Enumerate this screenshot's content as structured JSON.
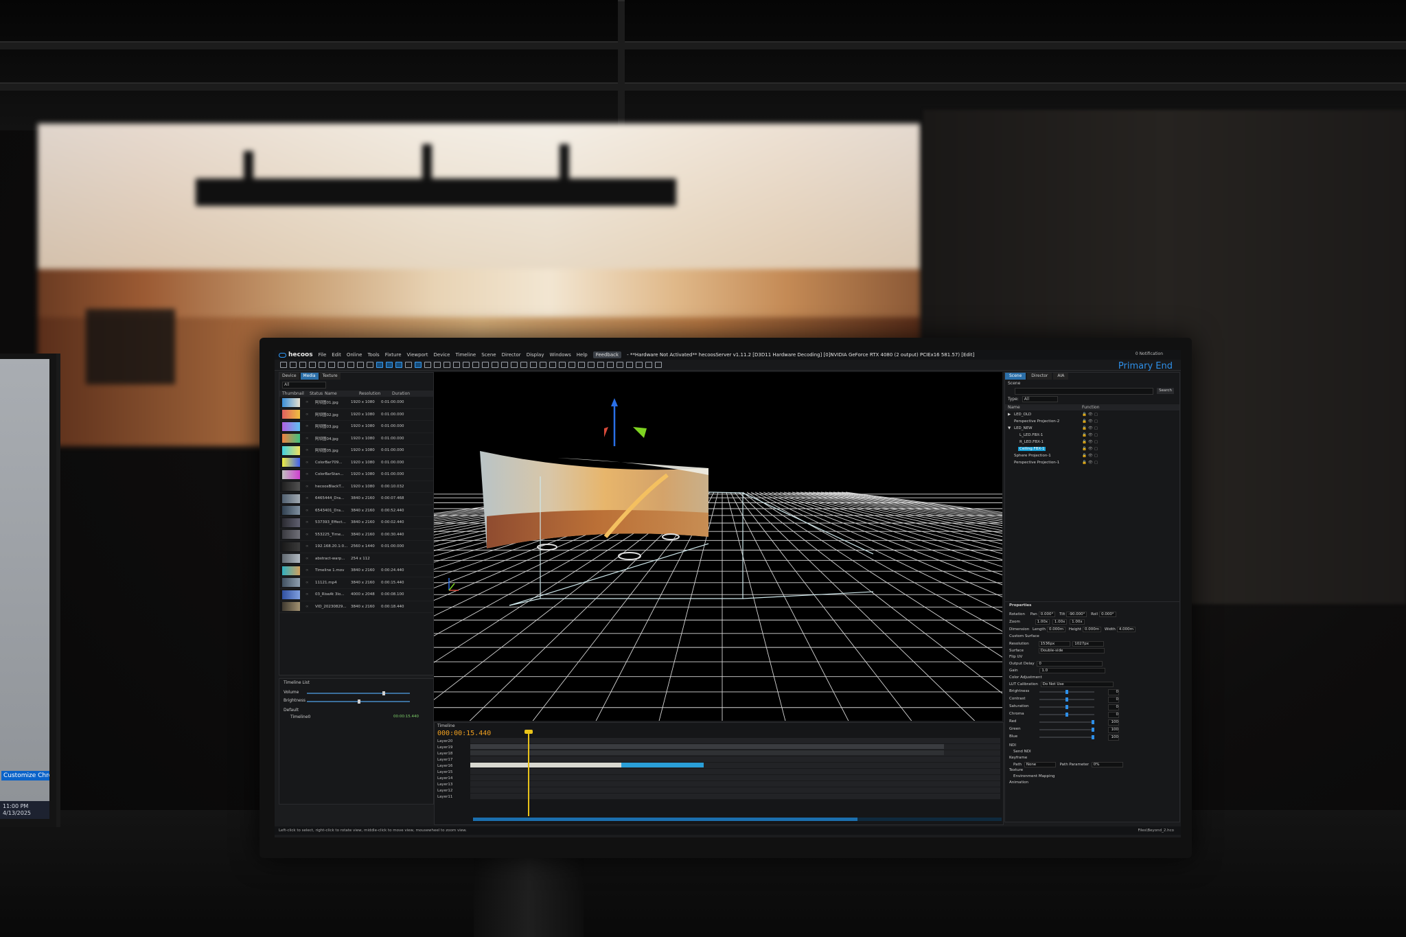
{
  "menubar": {
    "app_name": "hecoos",
    "items": [
      "File",
      "Edit",
      "Online",
      "Tools",
      "Fixture",
      "Viewport",
      "Device",
      "Timeline",
      "Scene",
      "Director",
      "Display",
      "Windows",
      "Help"
    ],
    "feedback": "Feedback",
    "title": "- **Hardware Not Activated** hecoosServer v1.11.2 [D3D11 Hardware Decoding] [0]NVIDIA GeForce RTX 4080 (2 output) PCIEx16 581.57) [Edit]",
    "notification": "0 Notification"
  },
  "viewport": {
    "label": "Primary End"
  },
  "media_panel": {
    "tabs": [
      "Device",
      "Media",
      "Texture"
    ],
    "filter": "All",
    "columns": [
      "Thumbnail",
      "Status",
      "Name",
      "Resolution",
      "Duration"
    ],
    "rows": [
      {
        "name": "阿坝图01.jpg",
        "res": "1920 x 1080",
        "dur": "0:01:00.000",
        "c1": "#3a8fd8",
        "c2": "#e6e0d0"
      },
      {
        "name": "阿坝图02.jpg",
        "res": "1920 x 1080",
        "dur": "0:01:00.000",
        "c1": "#e06060",
        "c2": "#f0c040"
      },
      {
        "name": "阿坝图03.jpg",
        "res": "1920 x 1080",
        "dur": "0:01:00.000",
        "c1": "#b060e0",
        "c2": "#60c0f0"
      },
      {
        "name": "阿坝图04.jpg",
        "res": "1920 x 1080",
        "dur": "0:01:00.000",
        "c1": "#f08040",
        "c2": "#40c080"
      },
      {
        "name": "阿坝图05.jpg",
        "res": "1920 x 1080",
        "dur": "0:01:00.000",
        "c1": "#40d0e0",
        "c2": "#f0e060"
      },
      {
        "name": "ColorBar709...",
        "res": "1920 x 1080",
        "dur": "0:01:00.000",
        "c1": "#f0f040",
        "c2": "#4060f0"
      },
      {
        "name": "ColorBarStan...",
        "res": "1920 x 1080",
        "dur": "0:01:00.000",
        "c1": "#c0c0c0",
        "c2": "#d040d0"
      },
      {
        "name": "hecoosBlackT...",
        "res": "1920 x 1080",
        "dur": "0:00:10.032",
        "c1": "#202020",
        "c2": "#505050"
      },
      {
        "name": "6465444_Dra...",
        "res": "3840 x 2160",
        "dur": "0:00:07.468",
        "c1": "#506070",
        "c2": "#a0a8b0"
      },
      {
        "name": "6543401_Dra...",
        "res": "3840 x 2160",
        "dur": "0:00:52.440",
        "c1": "#304050",
        "c2": "#8090a0"
      },
      {
        "name": "537393_Effect...",
        "res": "3840 x 2160",
        "dur": "0:00:02.440",
        "c1": "#2a2a30",
        "c2": "#606070"
      },
      {
        "name": "553225_Time...",
        "res": "3840 x 2160",
        "dur": "0:00:30.440",
        "c1": "#3a3a40",
        "c2": "#707078"
      },
      {
        "name": "192.168.20.1:0...",
        "res": "2560 x 1440",
        "dur": "0:01:00.000",
        "c1": "#1a1a1a",
        "c2": "#3a3a3a"
      },
      {
        "name": "abstract-warp...",
        "res": "254 x 112",
        "dur": "",
        "c1": "#606870",
        "c2": "#b0b8c0"
      },
      {
        "name": "Timeline 1.mov",
        "res": "3840 x 2160",
        "dur": "0:00:24.440",
        "c1": "#30b0c0",
        "c2": "#d0a060"
      },
      {
        "name": "11121.mp4",
        "res": "3840 x 2160",
        "dur": "0:00:15.440",
        "c1": "#405060",
        "c2": "#90a0b0"
      },
      {
        "name": "03_RiseAt 3lo...",
        "res": "4000 x 2048",
        "dur": "0:00:08.100",
        "c1": "#3050a0",
        "c2": "#80a0e0"
      },
      {
        "name": "VID_20230829...",
        "res": "3840 x 2160",
        "dur": "0:00:18.440",
        "c1": "#403a30",
        "c2": "#a09070"
      }
    ]
  },
  "timeline_list": {
    "title": "Timeline List",
    "volume": "Volume",
    "brightness": "Brightness",
    "group": "Default",
    "item": "Timeline0",
    "timecode": "00:00:15.440"
  },
  "scene_panel": {
    "tabs": [
      "Scene",
      "Director",
      "AIA"
    ],
    "label": "Scene",
    "search": "Search",
    "type_label": "Type:",
    "type_value": "All",
    "columns": [
      "Name",
      "Function"
    ],
    "tree": [
      {
        "label": "LED_OLD",
        "indent": 0,
        "arrow": "▶",
        "selected": false
      },
      {
        "label": "Perspective Projection-2",
        "indent": 0,
        "arrow": "",
        "selected": false
      },
      {
        "label": "LED_NEW",
        "indent": 0,
        "arrow": "▼",
        "selected": false
      },
      {
        "label": "L_LED.FBX-1",
        "indent": 1,
        "arrow": "",
        "selected": false
      },
      {
        "label": "R_LED.FBX-1",
        "indent": 1,
        "arrow": "",
        "selected": false
      },
      {
        "label": "Ceiling.FBX-1",
        "indent": 1,
        "arrow": "",
        "selected": true
      },
      {
        "label": "Sphere Projection-1",
        "indent": 0,
        "arrow": "",
        "selected": false
      },
      {
        "label": "Perspective Projection-1",
        "indent": 0,
        "arrow": "",
        "selected": false
      }
    ]
  },
  "properties": {
    "title": "Properties",
    "rotation": "Rotation",
    "pan": "Pan",
    "pan_v": "0.000°",
    "tilt": "Tilt",
    "tilt_v": "-90.000°",
    "roll": "Roll",
    "roll_v": "0.000°",
    "zoom": "Zoom",
    "zx": "1.00x",
    "zy": "1.00x",
    "zz": "1.00x",
    "dimension": "Dimension",
    "length": "Length",
    "length_v": "0.000m",
    "height": "Height",
    "height_v": "0.000m",
    "width": "Width",
    "width_v": "4.000m",
    "custom_surface": "Custom Surface",
    "resolution": "Resolution",
    "res_w": "1536px",
    "res_h": "1027px",
    "surface": "Surface",
    "surface_v": "Double-side",
    "flip_uv": "Flip UV",
    "output_delay": "Output Delay",
    "output_delay_v": "0",
    "gain": "Gain",
    "gain_v": "1.0",
    "color_adjustment": "Color Adjustment",
    "lut": "LUT Calibration",
    "lut_v": "Do Not Use",
    "sliders": [
      {
        "label": "Brightness",
        "value": "0",
        "pos": 0.5
      },
      {
        "label": "Contrast",
        "value": "0",
        "pos": 0.5
      },
      {
        "label": "Saturation",
        "value": "0",
        "pos": 0.5
      },
      {
        "label": "Chroma",
        "value": "0",
        "pos": 0.5
      },
      {
        "label": "Red",
        "value": "100",
        "pos": 1.0
      },
      {
        "label": "Green",
        "value": "100",
        "pos": 1.0
      },
      {
        "label": "Blue",
        "value": "100",
        "pos": 1.0
      }
    ],
    "ndi": "NDI",
    "send_ndi": "Send NDI",
    "keyframe": "Keyframe",
    "path": "Path",
    "path_v": "None",
    "path_param": "Path Parameter",
    "path_param_v": "0%",
    "texture": "Texture",
    "env_mapping": "Environment Mapping",
    "animation": "Animation"
  },
  "timeline": {
    "title": "Timeline",
    "timecode": "000:00:15.440",
    "layers": [
      "Layer20",
      "Layer19",
      "Layer18",
      "Layer17",
      "Layer16",
      "Layer15",
      "Layer14",
      "Layer13",
      "Layer12",
      "Layer11"
    ]
  },
  "status": {
    "hint": "Left-click to select, right-click to rotate view, middle-click to move view, mousewheel to zoom view.",
    "path": "Files\\Beyond_2.hco"
  },
  "side_monitor": {
    "button": "Customize Chrome",
    "time": "11:00 PM",
    "date": "4/13/2025"
  },
  "colors": {
    "accent": "#2e8fe8",
    "timecode": "#f0a020",
    "selection": "#16a0d6"
  }
}
